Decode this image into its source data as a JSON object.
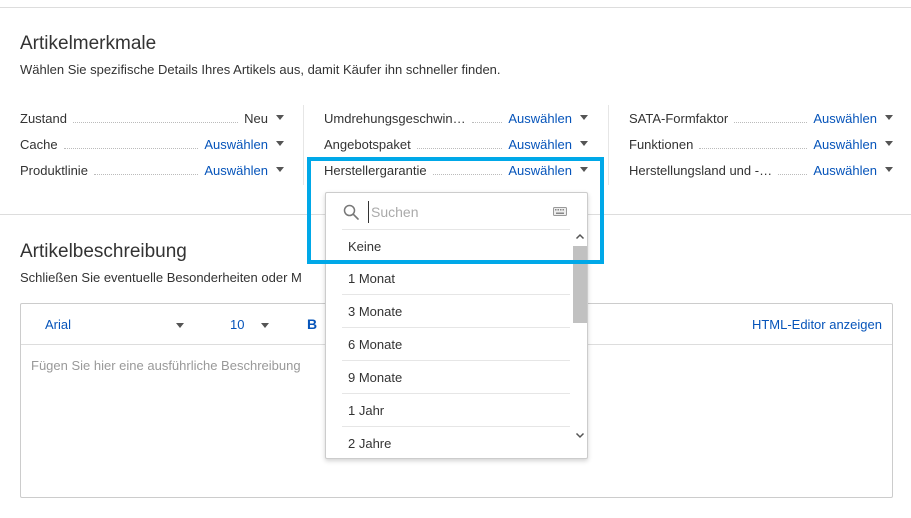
{
  "attributes": {
    "title": "Artikelmerkmale",
    "subtitle": "Wählen Sie spezifische Details Ihres Artikels aus, damit Käufer ihn schneller finden.",
    "columns": [
      [
        {
          "label": "Zustand",
          "value": "Neu"
        },
        {
          "label": "Cache",
          "value": "Auswählen"
        },
        {
          "label": "Produktlinie",
          "value": "Auswählen"
        }
      ],
      [
        {
          "label": "Umdrehungsgeschwin…",
          "value": "Auswählen"
        },
        {
          "label": "Angebotspaket",
          "value": "Auswählen"
        },
        {
          "label": "Herstellergarantie",
          "value": "Auswählen"
        }
      ],
      [
        {
          "label": "SATA-Formfaktor",
          "value": "Auswählen"
        },
        {
          "label": "Funktionen",
          "value": "Auswählen"
        },
        {
          "label": "Herstellungsland und -…",
          "value": "Auswählen"
        }
      ]
    ]
  },
  "description": {
    "title": "Artikelbeschreibung",
    "subtitle": "Schließen Sie eventuelle Besonderheiten oder M",
    "toolbar": {
      "font": "Arial",
      "size": "10",
      "bold": "B",
      "html_editor": "HTML-Editor anzeigen"
    },
    "placeholder": "Fügen Sie hier eine ausführliche Beschreibung"
  },
  "dropdown": {
    "search_placeholder": "Suchen",
    "options": [
      "Keine",
      "1 Monat",
      "3 Monate",
      "6 Monate",
      "9 Monate",
      "1 Jahr",
      "2 Jahre"
    ]
  },
  "colors": {
    "link": "#0654ba",
    "highlight": "#00a8e8"
  }
}
